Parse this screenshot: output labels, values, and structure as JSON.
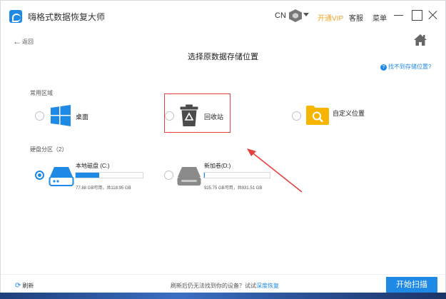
{
  "app": {
    "title": "嗨格式数据恢复大师"
  },
  "header": {
    "lang": "CN",
    "vip_label": "开通VIP",
    "service_label": "客服",
    "menu_label": "菜单"
  },
  "nav": {
    "back_label": "返回"
  },
  "page": {
    "title": "选择原数据存储位置",
    "help_link": "找不到存储位置?"
  },
  "common": {
    "label": "常用区域",
    "options": [
      {
        "label": "桌面",
        "checked": false
      },
      {
        "label": "回收站",
        "checked": false
      },
      {
        "label": "自定义位置",
        "checked": false
      }
    ]
  },
  "disks": {
    "label": "硬盘分区（2）",
    "items": [
      {
        "name": "本地磁盘 (C:)",
        "size_text": "77.88 GB可用，共118.95 GB",
        "used_fraction": 0.35,
        "checked": true
      },
      {
        "name": "新加卷(D:)",
        "size_text": "925.75 GB可用，共931.51 GB",
        "used_fraction": 0.006,
        "checked": false
      }
    ]
  },
  "footer": {
    "refresh_label": "刷新",
    "hint_text": "刷新后仍无法找到你的设备？试试",
    "hint_link": "深度恢复",
    "start_label": "开始扫描"
  },
  "colors": {
    "accent": "#1e8ae6",
    "vip": "#f0a32a",
    "highlight": "#e54040",
    "recycle": "#4b4b4b",
    "folder": "#f7b500"
  }
}
